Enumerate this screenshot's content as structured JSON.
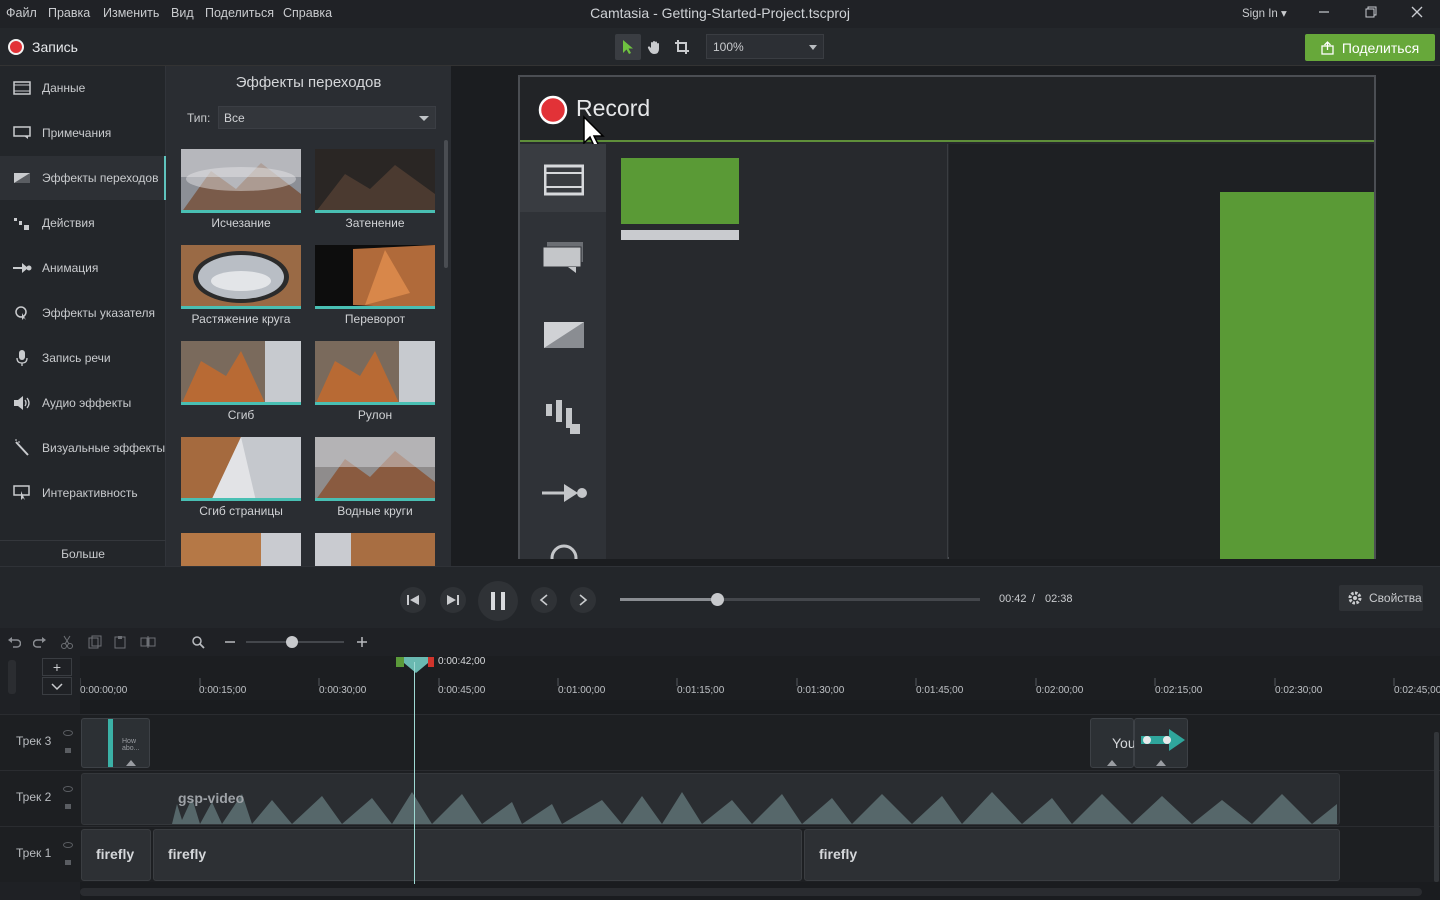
{
  "window": {
    "title": "Camtasia - Getting-Started-Project.tscproj",
    "sign_in": "Sign In",
    "menu": [
      "Файл",
      "Правка",
      "Изменить",
      "Вид",
      "Поделиться",
      "Справка"
    ]
  },
  "toolbar": {
    "record_label": "Запись",
    "zoom_value": "100%",
    "share_label": "Поделиться"
  },
  "sidebar": {
    "items": [
      {
        "label": "Данные",
        "icon": "media-icon"
      },
      {
        "label": "Примечания",
        "icon": "annotations-icon"
      },
      {
        "label": "Эффекты переходов",
        "icon": "transitions-icon"
      },
      {
        "label": "Действия",
        "icon": "behaviors-icon"
      },
      {
        "label": "Анимация",
        "icon": "animation-icon"
      },
      {
        "label": "Эффекты указателя",
        "icon": "cursor-effects-icon"
      },
      {
        "label": "Запись речи",
        "icon": "microphone-icon"
      },
      {
        "label": "Аудио эффекты",
        "icon": "speaker-icon"
      },
      {
        "label": "Визуальные эффекты",
        "icon": "wand-icon"
      },
      {
        "label": "Интерактивность",
        "icon": "interactivity-icon"
      }
    ],
    "active_index": 2,
    "more_label": "Больше"
  },
  "transitions": {
    "title": "Эффекты переходов",
    "type_label": "Тип:",
    "type_value": "Все",
    "items": [
      {
        "label": "Исчезание"
      },
      {
        "label": "Затенение"
      },
      {
        "label": "Растяжение круга"
      },
      {
        "label": "Переворот"
      },
      {
        "label": "Сгиб"
      },
      {
        "label": "Рулон"
      },
      {
        "label": "Сгиб страницы"
      },
      {
        "label": "Водные круги"
      }
    ]
  },
  "canvas": {
    "record_text": "Record"
  },
  "playback": {
    "time_current": "00:42",
    "time_separator": "/",
    "time_total": "02:38",
    "progress": 0.27,
    "properties_label": "Свойства"
  },
  "timeline": {
    "playhead_time": "0:00:42;00",
    "ticks": [
      "0:00:00;00",
      "0:00:15;00",
      "0:00:30;00",
      "0:00:45;00",
      "0:01:00;00",
      "0:01:15;00",
      "0:01:30;00",
      "0:01:45;00",
      "0:02:00;00",
      "0:02:15;00",
      "0:02:30;00",
      "0:02:45;00"
    ],
    "tracks": [
      {
        "name": "Трек 3"
      },
      {
        "name": "Трек 2"
      },
      {
        "name": "Трек 1"
      }
    ],
    "clips": {
      "track3_clip_text": "How abo...",
      "track3_you": "You",
      "track2_label": "gsp-video",
      "track1_a": "firefly",
      "track1_b": "firefly",
      "track1_c": "firefly"
    }
  },
  "colors": {
    "accent_green": "#67a83a",
    "teal": "#49bfb3",
    "record_red": "#e23237"
  }
}
